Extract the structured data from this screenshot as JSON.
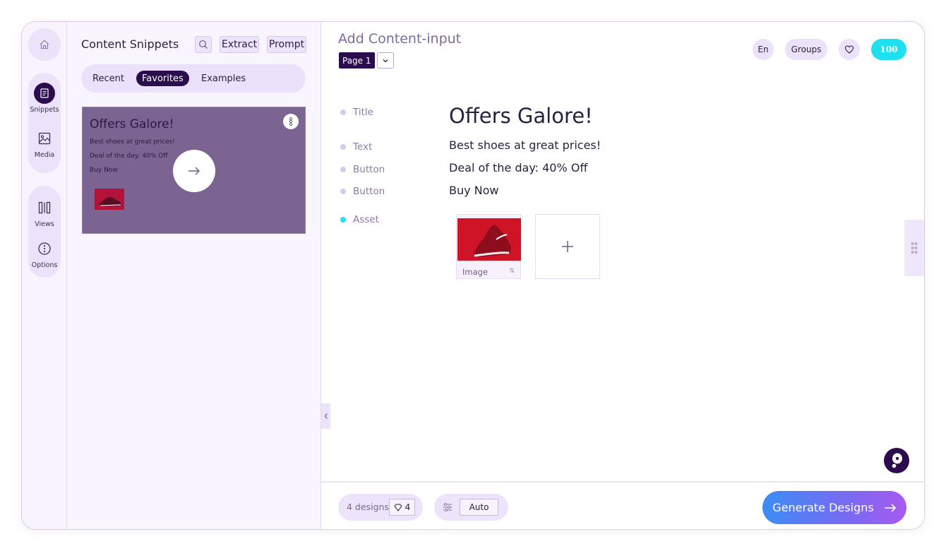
{
  "rail": {
    "items": [
      {
        "label": "Snippets"
      },
      {
        "label": "Media"
      },
      {
        "label": "Views"
      },
      {
        "label": "Options"
      }
    ]
  },
  "snippets": {
    "title": "Content Snippets",
    "extract_label": "Extract",
    "prompt_label": "Prompt",
    "tabs": [
      "Recent",
      "Favorites",
      "Examples"
    ],
    "active_tab": "Favorites",
    "card": {
      "title": "Offers Galore!",
      "lines": [
        "Best shoes at great prices!",
        "Deal of the day: 40% Off",
        "Buy Now"
      ]
    }
  },
  "main": {
    "title": "Add Content-input",
    "page_label": "Page 1",
    "language": "En",
    "groups_label": "Groups",
    "credits": "100",
    "fields": [
      {
        "label": "Title",
        "value": "Offers Galore!"
      },
      {
        "label": "Text",
        "value": "Best shoes at great prices!"
      },
      {
        "label": "Button",
        "value": "Deal of the day: 40% Off"
      },
      {
        "label": "Button",
        "value": "Buy Now"
      },
      {
        "label": "Asset",
        "value": ""
      }
    ],
    "asset_caption": "Image"
  },
  "footer": {
    "designs_label": "4 designs",
    "designs_count": "4",
    "mode_label": "Auto",
    "generate_label": "Generate Designs"
  },
  "colors": {
    "accent_dark": "#2b0d4e",
    "credits_cyan": "#1fe0ef",
    "generate_gradient_start": "#3c8cf6",
    "generate_gradient_end": "#a65af0"
  }
}
